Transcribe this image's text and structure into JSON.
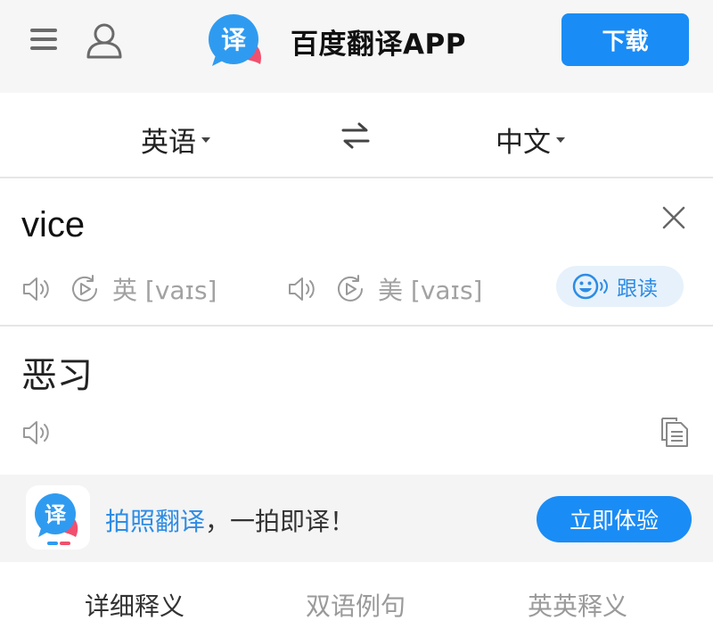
{
  "header": {
    "app_title": "百度翻译APP",
    "download_label": "下载",
    "logo_glyph": "译",
    "icons": [
      "menu-icon",
      "user-icon"
    ]
  },
  "languages": {
    "source": "英语",
    "target": "中文",
    "swap_icon": "swap-arrows-icon"
  },
  "source": {
    "word": "vice",
    "uk": {
      "label": "英 [vaɪs]"
    },
    "us": {
      "label": "美 [vaɪs]"
    },
    "follow_read_label": "跟读"
  },
  "translation": {
    "text": "恶习"
  },
  "promo": {
    "highlight": "拍照翻译",
    "rest": "，一拍即译！",
    "button_label": "立即体验",
    "logo_glyph": "译"
  },
  "tabs": [
    {
      "label": "详细释义",
      "active": true
    },
    {
      "label": "双语例句",
      "active": false
    },
    {
      "label": "英英释义",
      "active": false
    }
  ],
  "colors": {
    "accent": "#1a8cf5",
    "link_blue": "#2d8ce5",
    "header_bg": "#f6f6f6",
    "promo_bg": "#f4f4f4"
  }
}
